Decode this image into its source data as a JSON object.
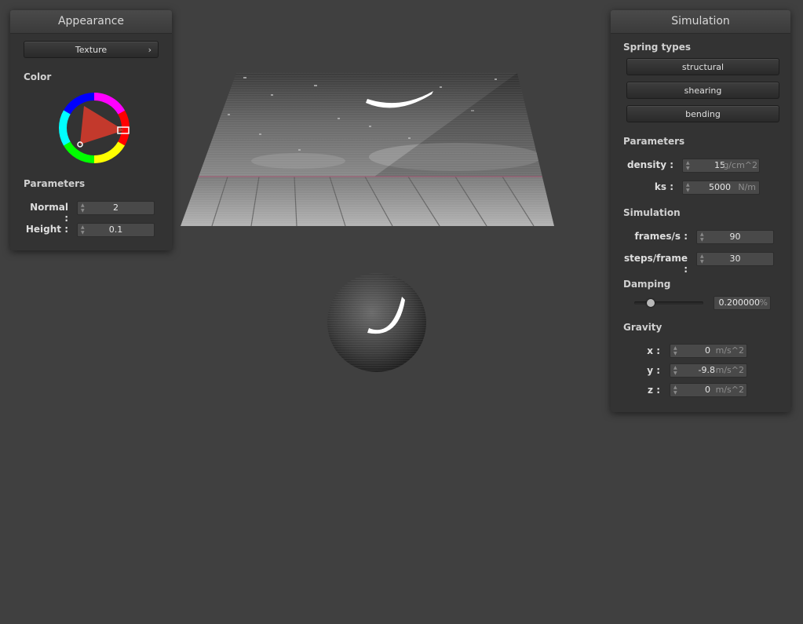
{
  "appearance": {
    "title": "Appearance",
    "texture_button": "Texture",
    "color_section": "Color",
    "parameters_section": "Parameters",
    "normal": {
      "label": "Normal :",
      "value": "2"
    },
    "height": {
      "label": "Height :",
      "value": "0.1"
    }
  },
  "simulation": {
    "title": "Simulation",
    "spring_types_section": "Spring types",
    "springs": [
      "structural",
      "shearing",
      "bending"
    ],
    "parameters_section": "Parameters",
    "density": {
      "label": "density :",
      "value": "15",
      "unit": "g/cm^2"
    },
    "ks": {
      "label": "ks :",
      "value": "5000",
      "unit": "N/m"
    },
    "simulation_section": "Simulation",
    "frames": {
      "label": "frames/s :",
      "value": "90"
    },
    "steps": {
      "label": "steps/frame :",
      "value": "30"
    },
    "damping_section": "Damping",
    "damping": {
      "value": "0.200000",
      "unit": "%",
      "level": 0.2
    },
    "gravity_section": "Gravity",
    "gx": {
      "label": "x :",
      "value": "0",
      "unit": "m/s^2"
    },
    "gy": {
      "label": "y :",
      "value": "-9.8",
      "unit": "m/s^2"
    },
    "gz": {
      "label": "z :",
      "value": "0",
      "unit": "m/s^2"
    }
  },
  "colors": {
    "background": "#404040",
    "panel": "#333333",
    "accent_red": "#e23a2a"
  }
}
